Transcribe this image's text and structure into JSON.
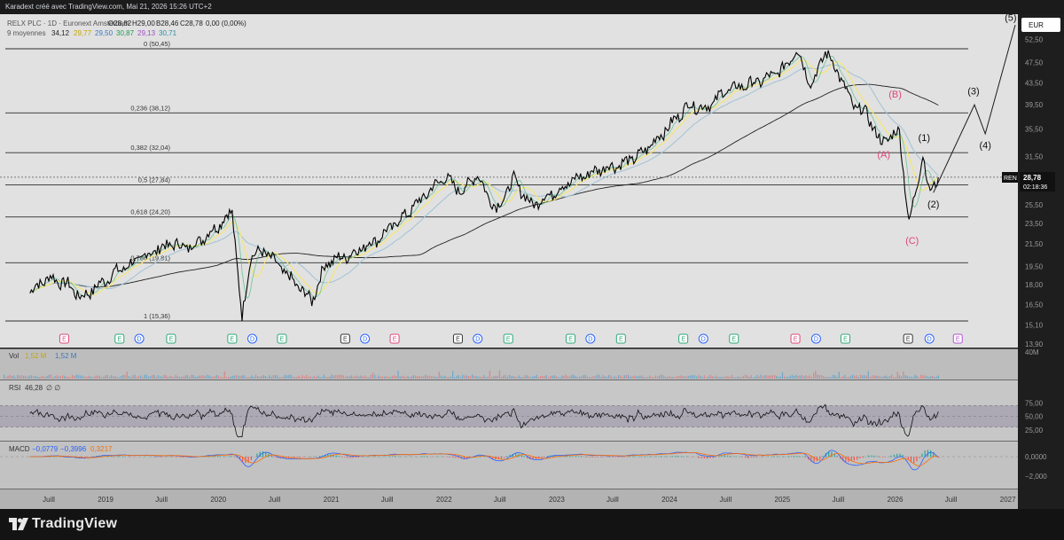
{
  "header": {
    "title": "Karadext créé avec TradingView.com, Mai 21, 2026 15:26 UTC+2"
  },
  "chart_data": {
    "type": "line",
    "symbol": {
      "name": "RELX PLC · 1D · Euronext Amsterdam",
      "open_label": "O28,82",
      "high_label": "H29,00",
      "low_label": "B28,46",
      "close_label": "C28,78",
      "change_label": "0,00 (0,00%)"
    },
    "ma_legend": {
      "label": "9 moyennes",
      "values": [
        {
          "value": "34,12",
          "color": "#d1d4dc"
        },
        {
          "value": "29,77",
          "color": "#f7e76b"
        },
        {
          "value": "29,50",
          "color": "#5b9bd5"
        },
        {
          "value": "30,87",
          "color": "#2ec46b"
        },
        {
          "value": "29,13",
          "color": "#c678dd"
        },
        {
          "value": "30,71",
          "color": "#4fb0c6"
        }
      ]
    },
    "currency": "EUR",
    "price_axis": {
      "ticks": [
        "52,50",
        "47,50",
        "43,50",
        "39,50",
        "35,50",
        "31,50",
        "28,00",
        "25,50",
        "23,50",
        "21,50",
        "19,50",
        "18,00",
        "16,50",
        "15,10",
        "13,90"
      ],
      "scale": "log"
    },
    "x_axis_ticks": [
      "Juill",
      "2019",
      "Juill",
      "2020",
      "Juill",
      "2021",
      "Juill",
      "2022",
      "Juill",
      "2023",
      "Juill",
      "2024",
      "Juill",
      "2025",
      "Juill",
      "2026",
      "Juill",
      "2027"
    ],
    "last_price": {
      "symbol": "REN",
      "value": "28,78",
      "countdown": "02:18:36"
    },
    "fib_levels": [
      {
        "label": "0 (50,45)",
        "price": 50.45
      },
      {
        "label": "0,236 (38,12)",
        "price": 38.12
      },
      {
        "label": "0,382 (32,04)",
        "price": 32.04
      },
      {
        "label": "0,5 (27,84)",
        "price": 27.84
      },
      {
        "label": "0,618 (24,20)",
        "price": 24.2
      },
      {
        "label": "0,786 (19,81)",
        "price": 19.81
      },
      {
        "label": "1 (15,36)",
        "price": 15.36
      }
    ],
    "price_series": [
      {
        "date": "2018-05-01",
        "close": 17.5
      },
      {
        "date": "2018-07-01",
        "close": 18.6
      },
      {
        "date": "2018-09-01",
        "close": 18.0
      },
      {
        "date": "2018-10-15",
        "close": 17.0
      },
      {
        "date": "2018-12-01",
        "close": 17.8
      },
      {
        "date": "2019-02-01",
        "close": 19.0
      },
      {
        "date": "2019-04-01",
        "close": 19.8
      },
      {
        "date": "2019-06-01",
        "close": 20.8
      },
      {
        "date": "2019-08-01",
        "close": 21.5
      },
      {
        "date": "2019-10-01",
        "close": 21.2
      },
      {
        "date": "2019-12-01",
        "close": 22.5
      },
      {
        "date": "2020-02-15",
        "close": 24.8
      },
      {
        "date": "2020-03-18",
        "close": 15.5
      },
      {
        "date": "2020-04-15",
        "close": 20.5
      },
      {
        "date": "2020-06-01",
        "close": 20.8
      },
      {
        "date": "2020-08-01",
        "close": 19.0
      },
      {
        "date": "2020-10-30",
        "close": 16.8
      },
      {
        "date": "2020-12-15",
        "close": 19.8
      },
      {
        "date": "2021-03-01",
        "close": 20.5
      },
      {
        "date": "2021-06-01",
        "close": 22.0
      },
      {
        "date": "2021-09-01",
        "close": 24.5
      },
      {
        "date": "2021-12-31",
        "close": 28.8
      },
      {
        "date": "2022-03-01",
        "close": 27.0
      },
      {
        "date": "2022-04-15",
        "close": 29.2
      },
      {
        "date": "2022-06-20",
        "close": 25.0
      },
      {
        "date": "2022-08-15",
        "close": 28.5
      },
      {
        "date": "2022-10-10",
        "close": 25.5
      },
      {
        "date": "2022-12-01",
        "close": 26.5
      },
      {
        "date": "2023-03-01",
        "close": 28.5
      },
      {
        "date": "2023-06-01",
        "close": 30.0
      },
      {
        "date": "2023-08-01",
        "close": 30.5
      },
      {
        "date": "2023-10-01",
        "close": 31.8
      },
      {
        "date": "2024-01-01",
        "close": 36.0
      },
      {
        "date": "2024-03-01",
        "close": 39.5
      },
      {
        "date": "2024-05-01",
        "close": 39.0
      },
      {
        "date": "2024-07-01",
        "close": 42.0
      },
      {
        "date": "2024-09-01",
        "close": 43.0
      },
      {
        "date": "2024-11-01",
        "close": 44.0
      },
      {
        "date": "2025-01-01",
        "close": 46.0
      },
      {
        "date": "2025-02-15",
        "close": 50.4
      },
      {
        "date": "2025-04-07",
        "close": 43.0
      },
      {
        "date": "2025-05-20",
        "close": 50.0
      },
      {
        "date": "2025-07-01",
        "close": 45.5
      },
      {
        "date": "2025-08-15",
        "close": 39.5
      },
      {
        "date": "2025-10-01",
        "close": 38.0
      },
      {
        "date": "2025-11-15",
        "close": 33.5
      },
      {
        "date": "2026-01-15",
        "close": 35.2
      },
      {
        "date": "2026-02-15",
        "close": 23.3
      },
      {
        "date": "2026-03-15",
        "close": 28.5
      },
      {
        "date": "2026-04-01",
        "close": 31.8
      },
      {
        "date": "2026-04-20",
        "close": 27.0
      },
      {
        "date": "2026-05-21",
        "close": 28.78
      }
    ],
    "projection_path": [
      {
        "date": "2026-05-05",
        "price": 26.9
      },
      {
        "date": "2026-09-15",
        "price": 39.5
      },
      {
        "date": "2026-10-20",
        "price": 34.8
      },
      {
        "date": "2027-01-25",
        "price": 56.0
      }
    ],
    "wave_labels": [
      {
        "text": "(5)",
        "date": "2027-01-10",
        "price": 57.0,
        "color": "#d1d4dc"
      },
      {
        "text": "(3)",
        "date": "2026-09-12",
        "price": 41.3,
        "color": "#d1d4dc"
      },
      {
        "text": "(4)",
        "date": "2026-10-20",
        "price": 32.6,
        "color": "#d1d4dc"
      },
      {
        "text": "(1)",
        "date": "2026-04-05",
        "price": 33.7,
        "color": "#d1d4dc"
      },
      {
        "text": "(2)",
        "date": "2026-05-05",
        "price": 25.2,
        "color": "#d1d4dc"
      },
      {
        "text": "(B)",
        "date": "2026-01-01",
        "price": 40.8,
        "color": "#e0457b"
      },
      {
        "text": "(A)",
        "date": "2025-11-25",
        "price": 31.3,
        "color": "#e0457b"
      },
      {
        "text": "(C)",
        "date": "2026-02-25",
        "price": 21.5,
        "color": "#e0457b"
      }
    ],
    "event_markers": [
      {
        "letter": "E",
        "date": "2018-08-20",
        "kind": "earn-red"
      },
      {
        "letter": "E",
        "date": "2019-02-15",
        "kind": "earn-green"
      },
      {
        "letter": "D",
        "date": "2019-04-20",
        "kind": "div"
      },
      {
        "letter": "E",
        "date": "2019-08-01",
        "kind": "earn-green"
      },
      {
        "letter": "E",
        "date": "2020-02-15",
        "kind": "earn-green"
      },
      {
        "letter": "D",
        "date": "2020-04-20",
        "kind": "div"
      },
      {
        "letter": "E",
        "date": "2020-07-25",
        "kind": "earn-green"
      },
      {
        "letter": "E",
        "date": "2021-02-15",
        "kind": "earn-gray"
      },
      {
        "letter": "D",
        "date": "2021-04-20",
        "kind": "div"
      },
      {
        "letter": "E",
        "date": "2021-07-25",
        "kind": "earn-red"
      },
      {
        "letter": "E",
        "date": "2022-02-15",
        "kind": "earn-gray"
      },
      {
        "letter": "D",
        "date": "2022-04-20",
        "kind": "div"
      },
      {
        "letter": "E",
        "date": "2022-07-28",
        "kind": "earn-green"
      },
      {
        "letter": "E",
        "date": "2023-02-15",
        "kind": "earn-green"
      },
      {
        "letter": "D",
        "date": "2023-04-20",
        "kind": "div"
      },
      {
        "letter": "E",
        "date": "2023-07-28",
        "kind": "earn-green"
      },
      {
        "letter": "E",
        "date": "2024-02-15",
        "kind": "earn-green"
      },
      {
        "letter": "D",
        "date": "2024-04-20",
        "kind": "div"
      },
      {
        "letter": "E",
        "date": "2024-07-28",
        "kind": "earn-green"
      },
      {
        "letter": "E",
        "date": "2025-02-12",
        "kind": "earn-red"
      },
      {
        "letter": "D",
        "date": "2025-04-20",
        "kind": "div"
      },
      {
        "letter": "E",
        "date": "2025-07-24",
        "kind": "earn-green"
      },
      {
        "letter": "E",
        "date": "2026-02-12",
        "kind": "earn-gray"
      },
      {
        "letter": "D",
        "date": "2026-04-22",
        "kind": "div"
      },
      {
        "letter": "E",
        "date": "2026-07-23",
        "kind": "earn-purple"
      }
    ],
    "volume_panel": {
      "label": "Vol",
      "value_a": "1,52 M",
      "value_b": "1,52 M",
      "scale_label": "40M"
    },
    "rsi_panel": {
      "label": "RSI",
      "value": "46,28",
      "extra": "∅ ∅",
      "ticks": [
        "75,00",
        "50,00",
        "25,00"
      ],
      "upper": 70,
      "lower": 30
    },
    "macd_panel": {
      "label": "MACD",
      "macd": "−0,0779",
      "signal": "−0,3996",
      "hist": "0,3217",
      "ticks": [
        "0,0000",
        "−2,000"
      ]
    },
    "colors": {
      "background": "#1e1e1e",
      "price": "#000000",
      "ma_fast": "#f7e76b",
      "ma_mid": "#9fc2d6",
      "ma_slow": "#222222",
      "fib": "#2e2e2e",
      "rsi_band": "#5a4b7a",
      "macd": "#2962ff",
      "signal": "#ff6d00",
      "hist_pos": "#26a69a",
      "hist_neg": "#ef5350"
    }
  },
  "footer": {
    "brand": "TradingView"
  }
}
